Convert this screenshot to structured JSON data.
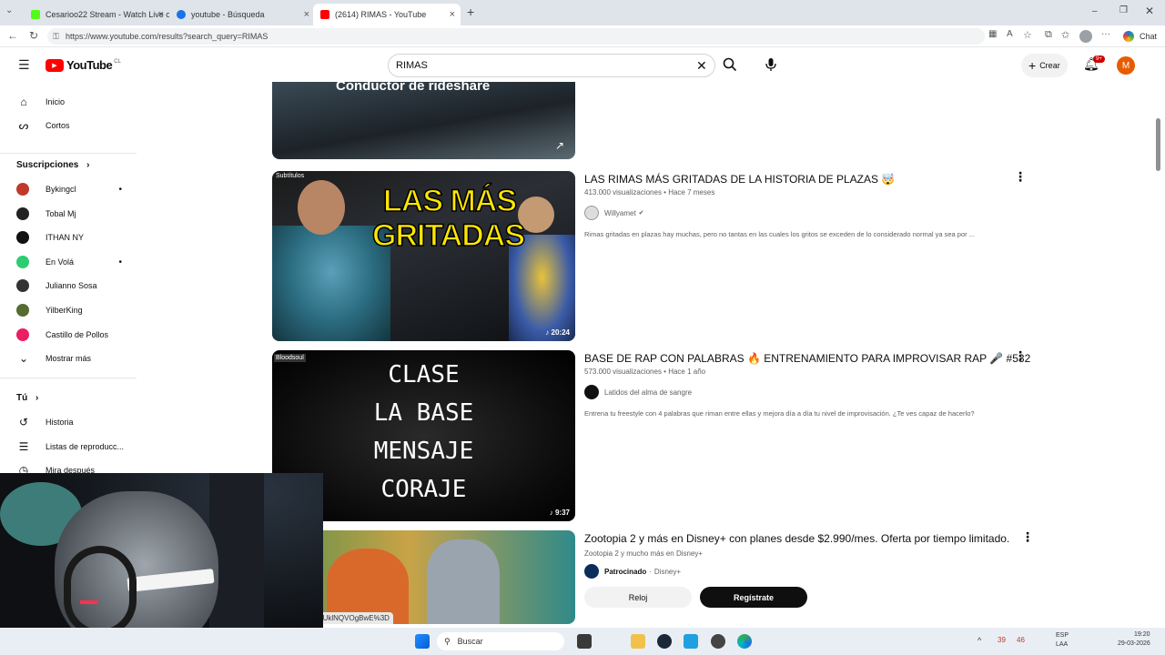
{
  "browser": {
    "tabs": [
      {
        "label": "Cesarioo22 Stream - Watch Live o",
        "color": "#53fc18"
      },
      {
        "label": "youtube - Búsqueda",
        "color": "#1a73e8"
      },
      {
        "label": "(2614) RIMAS - YouTube",
        "color": "#ff0000"
      }
    ],
    "url": "https://www.youtube.com/results?search_query=RIMAS",
    "chat_label": "Chat"
  },
  "header": {
    "logo_text": "YouTube",
    "region": "CL",
    "search_value": "RIMAS",
    "create_label": "Crear",
    "notif_badge": "9+",
    "avatar_letter": "M"
  },
  "sidebar": {
    "main": [
      {
        "label": "Inicio",
        "icon": "home-icon"
      },
      {
        "label": "Cortos",
        "icon": "shorts-icon"
      }
    ],
    "subs_title": "Suscripciones",
    "subs": [
      {
        "label": "Bykingcl",
        "color": "#c0392b",
        "dot": true
      },
      {
        "label": "Tobal Mj",
        "color": "#222222",
        "dot": false
      },
      {
        "label": "ITHAN NY",
        "color": "#111111",
        "dot": false
      },
      {
        "label": "En Volá",
        "color": "#2ecc71",
        "dot": true
      },
      {
        "label": "Julianno Sosa",
        "color": "#333333",
        "dot": false
      },
      {
        "label": "YilberKing",
        "color": "#556b2f",
        "dot": false
      },
      {
        "label": "Castillo de Pollos",
        "color": "#e91e63",
        "dot": false
      }
    ],
    "more_label": "Mostrar más",
    "you_title": "Tú",
    "you": [
      {
        "label": "Historia",
        "icon": "history-icon"
      },
      {
        "label": "Listas de reproducc...",
        "icon": "playlist-icon"
      },
      {
        "label": "Mira después",
        "icon": "watch-later-icon"
      }
    ]
  },
  "results": {
    "partial": {
      "thumb_text": "Conductor de rideshare"
    },
    "videos": [
      {
        "title": "LAS RIMAS MÁS GRITADAS DE LA HISTORIA DE PLAZAS 🤯",
        "meta": "413.000 visualizaciones • Hace 7 meses",
        "channel": "Willyamet",
        "verified": "✔",
        "desc": "Rimas gritadas en plazas hay muchas, pero no tantas en las cuales los gritos se exceden de lo considerado normal ya sea por ...",
        "duration": "20:24",
        "thumb_lines": [
          "LAS MÁS",
          "GRITADAS"
        ],
        "thumb_badge": "Subtítulos"
      },
      {
        "title": "BASE DE RAP CON PALABRAS 🔥 ENTRENAMIENTO PARA IMPROVISAR RAP 🎤 #532",
        "meta": "573.000 visualizaciones • Hace 1 año",
        "channel": "Latidos del alma de sangre",
        "desc": "Entrena tu freestyle con 4 palabras que riman entre ellas y mejora día a día tu nivel de improvisación. ¿Te ves capaz de hacerlo?",
        "duration": "9:37",
        "thumb_lines": [
          "CLASE",
          "LA BASE",
          "MENSAJE",
          "CORAJE"
        ],
        "thumb_badge": "Bloodsoul"
      }
    ],
    "ad": {
      "title": "Zootopia 2 y más en Disney+ con planes desde $2.990/mes. Oferta por tiempo limitado.",
      "meta": "Zootopia 2 y mucho más en Disney+",
      "sponsored": "Patrocinado",
      "advertiser": "Disney+",
      "btn_secondary": "Reloj",
      "btn_primary": "Regístrate",
      "thumb_tag": "A2",
      "link_preview": "o=1&pp=ygUFUklNQVOgBwE%3D"
    }
  },
  "taskbar": {
    "search_label": "Buscar",
    "tray_temp": "39",
    "tray_num": "46",
    "lang": "ESP",
    "region": "LAA",
    "time": "19:20",
    "date": "29-03-2026"
  },
  "colors": {
    "yt_red": "#ff0000",
    "accent_orange": "#e65c00",
    "verified_gray": "#606060"
  }
}
